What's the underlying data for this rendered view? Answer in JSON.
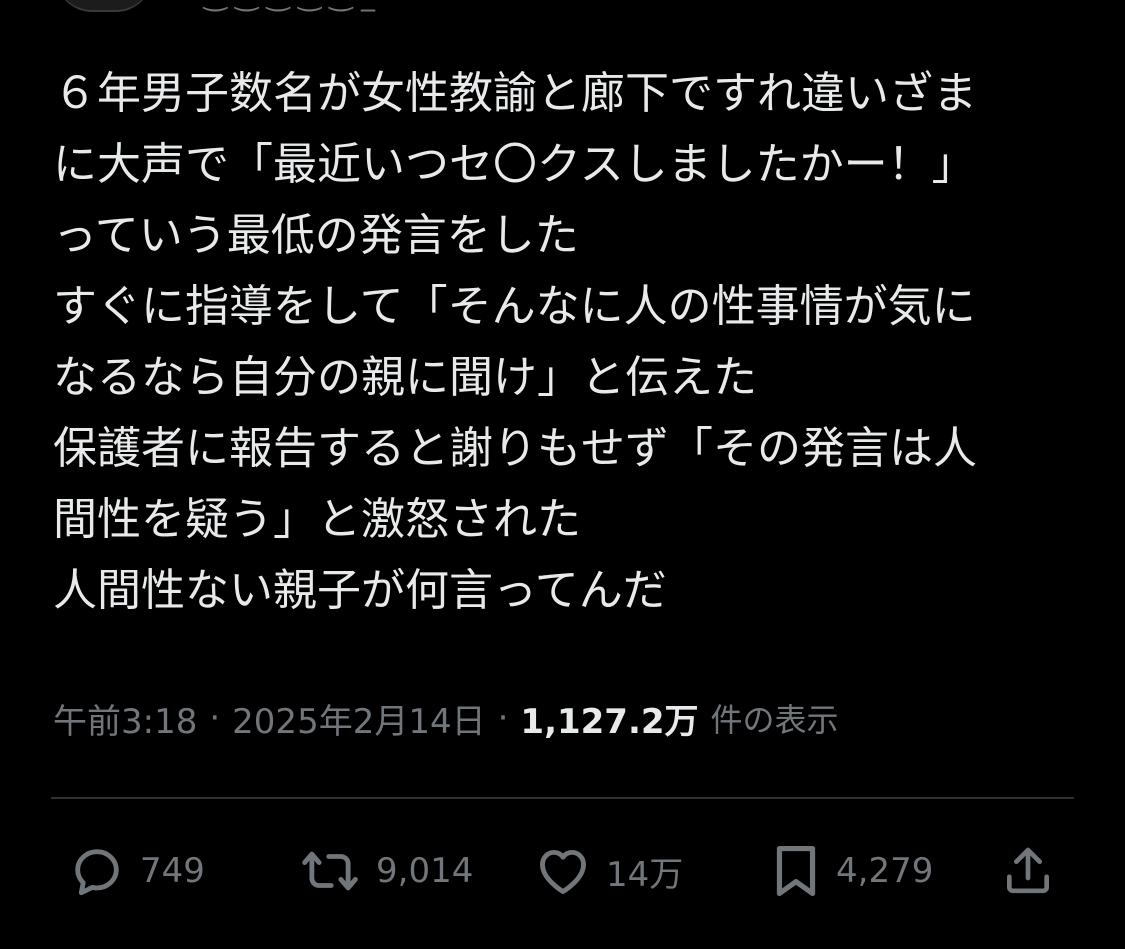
{
  "tweet": {
    "lines": [
      "６年男子数名が女性教諭と廊下ですれ違いざま",
      "に大声で「最近いつセ〇クスしましたかー！」",
      "っていう最低の発言をした",
      "すぐに指導をして「そんなに人の性事情が気に",
      "なるなら自分の親に聞け」と伝えた",
      "保護者に報告すると謝りもせず「その発言は人",
      "間性を疑う」と激怒された",
      "人間性ない親子が何言ってんだ"
    ]
  },
  "meta": {
    "time": "午前3:18",
    "separator": "·",
    "date": "2025年2月14日",
    "views_count": "1,127.2万",
    "views_label": "件の表示"
  },
  "actions": {
    "reply_count": "749",
    "repost_count": "9,014",
    "like_count": "14万",
    "bookmark_count": "4,279"
  },
  "icons": {
    "reply": "reply-icon",
    "repost": "repost-icon",
    "like": "heart-icon",
    "bookmark": "bookmark-icon",
    "share": "share-icon"
  },
  "colors": {
    "background": "#000000",
    "text_primary": "#e7e9ea",
    "text_secondary": "#71767b",
    "divider": "#2f3336"
  }
}
